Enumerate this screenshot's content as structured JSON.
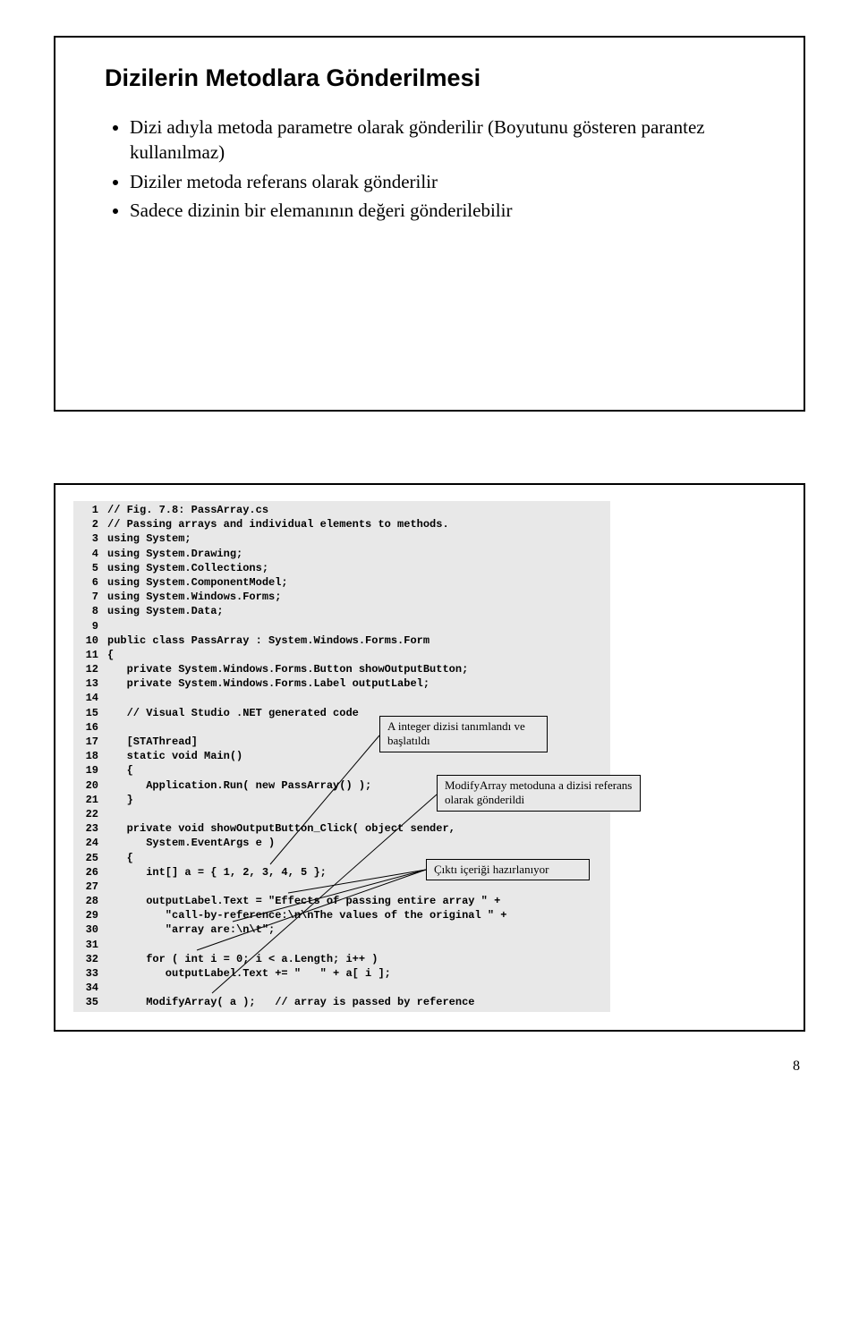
{
  "slide": {
    "title": "Dizilerin Metodlara Gönderilmesi",
    "bullets": [
      "Dizi adıyla metoda parametre olarak gönderilir (Boyutunu gösteren parantez kullanılmaz)",
      "Diziler metoda referans olarak gönderilir",
      "Sadece dizinin bir elemanının değeri gönderilebilir"
    ]
  },
  "code": {
    "lines": [
      {
        "n": "1",
        "t": "// Fig. 7.8: PassArray.cs"
      },
      {
        "n": "2",
        "t": "// Passing arrays and individual elements to methods."
      },
      {
        "n": "3",
        "t": "using System;"
      },
      {
        "n": "4",
        "t": "using System.Drawing;"
      },
      {
        "n": "5",
        "t": "using System.Collections;"
      },
      {
        "n": "6",
        "t": "using System.ComponentModel;"
      },
      {
        "n": "7",
        "t": "using System.Windows.Forms;"
      },
      {
        "n": "8",
        "t": "using System.Data;"
      },
      {
        "n": "9",
        "t": ""
      },
      {
        "n": "10",
        "t": "public class PassArray : System.Windows.Forms.Form"
      },
      {
        "n": "11",
        "t": "{"
      },
      {
        "n": "12",
        "t": "   private System.Windows.Forms.Button showOutputButton;"
      },
      {
        "n": "13",
        "t": "   private System.Windows.Forms.Label outputLabel;"
      },
      {
        "n": "14",
        "t": ""
      },
      {
        "n": "15",
        "t": "   // Visual Studio .NET generated code"
      },
      {
        "n": "16",
        "t": ""
      },
      {
        "n": "17",
        "t": "   [STAThread]"
      },
      {
        "n": "18",
        "t": "   static void Main()"
      },
      {
        "n": "19",
        "t": "   {"
      },
      {
        "n": "20",
        "t": "      Application.Run( new PassArray() );"
      },
      {
        "n": "21",
        "t": "   }"
      },
      {
        "n": "22",
        "t": ""
      },
      {
        "n": "23",
        "t": "   private void showOutputButton_Click( object sender,"
      },
      {
        "n": "24",
        "t": "      System.EventArgs e )"
      },
      {
        "n": "25",
        "t": "   {"
      },
      {
        "n": "26",
        "t": "      int[] a = { 1, 2, 3, 4, 5 };"
      },
      {
        "n": "27",
        "t": ""
      },
      {
        "n": "28",
        "t": "      outputLabel.Text = \"Effects of passing entire array \" +"
      },
      {
        "n": "29",
        "t": "         \"call-by-reference:\\n\\nThe values of the original \" +"
      },
      {
        "n": "30",
        "t": "         \"array are:\\n\\t\";"
      },
      {
        "n": "31",
        "t": ""
      },
      {
        "n": "32",
        "t": "      for ( int i = 0; i < a.Length; i++ )"
      },
      {
        "n": "33",
        "t": "         outputLabel.Text += \"   \" + a[ i ];"
      },
      {
        "n": "34",
        "t": ""
      },
      {
        "n": "35",
        "t": "      ModifyArray( a );   // array is passed by reference"
      }
    ]
  },
  "callouts": {
    "c1": "A integer dizisi tanımlandı ve başlatıldı",
    "c2": "ModifyArray metoduna a dizisi referans olarak gönderildi",
    "c3": "Çıktı içeriği hazırlanıyor"
  },
  "pageNumber": "8"
}
